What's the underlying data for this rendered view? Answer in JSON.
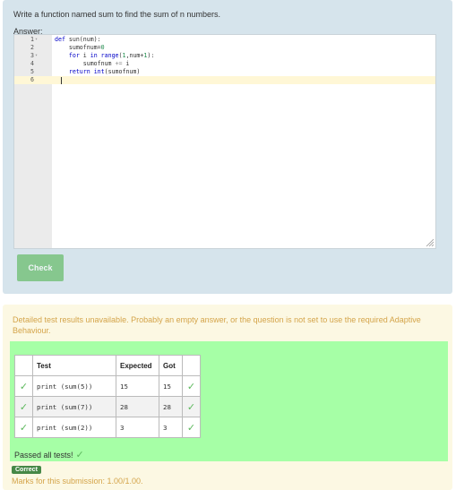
{
  "question": {
    "text": "Write a function named sum to find the sum of n numbers.",
    "answer_label": "Answer:"
  },
  "editor": {
    "lines": [
      {
        "number": "1",
        "fold": true,
        "segments": [
          {
            "t": "def",
            "c": "kw"
          },
          {
            "t": " sun(num):"
          }
        ]
      },
      {
        "number": "2",
        "fold": false,
        "segments": [
          {
            "t": "    sumofnum="
          },
          {
            "t": "0",
            "c": "num"
          }
        ]
      },
      {
        "number": "3",
        "fold": true,
        "segments": [
          {
            "t": "    "
          },
          {
            "t": "for",
            "c": "kw"
          },
          {
            "t": " i "
          },
          {
            "t": "in",
            "c": "kw"
          },
          {
            "t": " "
          },
          {
            "t": "range",
            "c": "kw"
          },
          {
            "t": "("
          },
          {
            "t": "1",
            "c": "num"
          },
          {
            "t": ",num+"
          },
          {
            "t": "1",
            "c": "num"
          },
          {
            "t": "):"
          }
        ]
      },
      {
        "number": "4",
        "fold": false,
        "segments": [
          {
            "t": "        sumofnum "
          },
          {
            "t": "+=",
            "c": "op"
          },
          {
            "t": " i"
          }
        ]
      },
      {
        "number": "5",
        "fold": false,
        "segments": [
          {
            "t": "    "
          },
          {
            "t": "return",
            "c": "kw"
          },
          {
            "t": " "
          },
          {
            "t": "int",
            "c": "kw"
          },
          {
            "t": "(sumofnum)"
          }
        ]
      },
      {
        "number": "6",
        "fold": false,
        "segments": []
      }
    ]
  },
  "check_button": {
    "label": "Check"
  },
  "feedback": {
    "message": "Detailed test results unavailable. Probably an empty answer, or the question is not set to use the required Adaptive Behaviour.",
    "table": {
      "headers": {
        "test": "Test",
        "expected": "Expected",
        "got": "Got"
      },
      "rows": [
        {
          "test": "print (sum(5))",
          "expected": "15",
          "got": "15"
        },
        {
          "test": "print (sum(7))",
          "expected": "28",
          "got": "28"
        },
        {
          "test": "print (sum(2))",
          "expected": "3",
          "got": "3"
        }
      ]
    },
    "passed_text": "Passed all tests!",
    "badge": "Correct",
    "marks": "Marks for this submission: 1.00/1.00."
  },
  "icons": {
    "tick": "check-icon",
    "fold": "fold-arrow-icon",
    "resize": "resize-grip-icon"
  },
  "colors": {
    "question_bg": "#d6e4ec",
    "feedback_bg": "#fcf8e3",
    "results_bg": "#a6ffa6",
    "check_button": "#5cb85c",
    "tick": "#5cb85c",
    "badge_bg": "#468847",
    "feedback_text": "#d4a44a",
    "keyword": "#0000c8",
    "number": "#1d8a4b"
  }
}
